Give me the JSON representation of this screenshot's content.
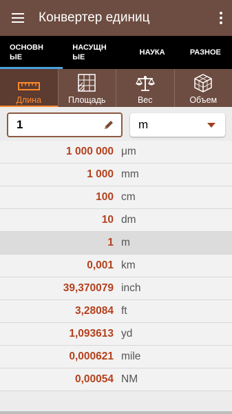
{
  "app_title": "Конвертер единиц",
  "category_tabs": [
    {
      "label": "ОСНОВН\nЫЕ"
    },
    {
      "label": "НАСУЩН\nЫЕ"
    },
    {
      "label": "НАУКА"
    },
    {
      "label": "РАЗНОЕ"
    }
  ],
  "type_tabs": [
    {
      "label": "Длина",
      "icon": "ruler-icon"
    },
    {
      "label": "Площадь",
      "icon": "area-grid-icon"
    },
    {
      "label": "Вес",
      "icon": "scale-icon"
    },
    {
      "label": "Объем",
      "icon": "cube-icon"
    }
  ],
  "input": {
    "value": "1",
    "unit": "m"
  },
  "results": [
    {
      "value": "1 000 000",
      "unit": "μm"
    },
    {
      "value": "1 000",
      "unit": "mm"
    },
    {
      "value": "100",
      "unit": "cm"
    },
    {
      "value": "10",
      "unit": "dm"
    },
    {
      "value": "1",
      "unit": "m"
    },
    {
      "value": "0,001",
      "unit": "km"
    },
    {
      "value": "39,370079",
      "unit": "inch"
    },
    {
      "value": "3,28084",
      "unit": "ft"
    },
    {
      "value": "1,093613",
      "unit": "yd"
    },
    {
      "value": "0,000621",
      "unit": "mile"
    },
    {
      "value": "0,00054",
      "unit": "NM"
    }
  ],
  "colors": {
    "appbar": "#6d4c41",
    "accent": "#ff8a2a",
    "value_text": "#b3411d",
    "tab_indicator": "#4aa3df"
  }
}
